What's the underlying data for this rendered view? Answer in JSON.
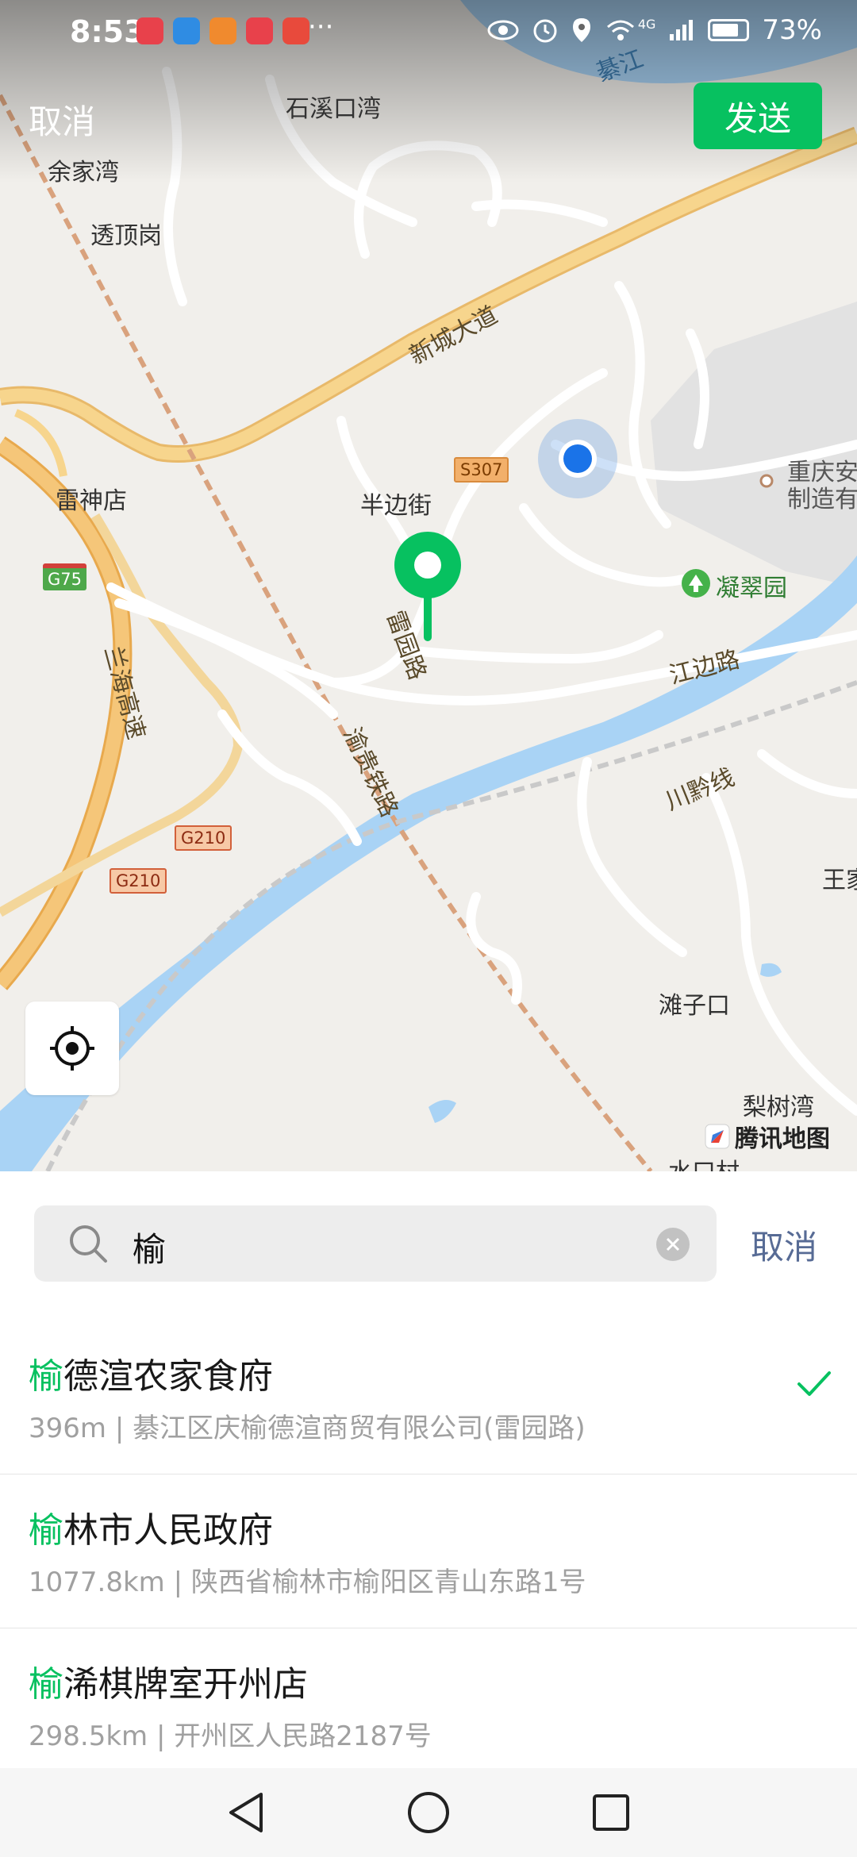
{
  "status_bar": {
    "time": "8:53",
    "more": "···",
    "network": "4G",
    "battery": "73%"
  },
  "header": {
    "cancel_label": "取消",
    "send_label": "发送"
  },
  "map": {
    "labels": {
      "shixikouwan": "石溪口湾",
      "yujiawan": "余家湾",
      "toudinggang": "透顶岗",
      "leishendian": "雷神店",
      "banbianjie": "半边街",
      "chongqing_an": "重庆安",
      "zhizaoyou": "制造有",
      "ningcuiyuan": "凝翠园",
      "tanzikou": "滩子口",
      "lishuwan": "梨树湾",
      "shuikoucun": "水口村",
      "wangjia": "王家",
      "qijiang": "綦江"
    },
    "roads": {
      "xinchengdadao": "新城大道",
      "leiyuanlu": "雷园路",
      "jiangbianlu": "江边路",
      "lanhaigaosu": "兰海高速",
      "yuguitielu": "渝贵铁路",
      "chuanqianxian": "川黔线"
    },
    "shields": {
      "s307": "S307",
      "g75": "G75",
      "g210_a": "G210",
      "g210_b": "G210"
    },
    "watermark": "腾讯地图"
  },
  "search": {
    "query": "榆",
    "cancel_label": "取消"
  },
  "results": [
    {
      "highlight": "榆",
      "rest": "德渲农家食府",
      "subtitle": "396m | 綦江区庆榆德渲商贸有限公司(雷园路)",
      "selected": true
    },
    {
      "highlight": "榆",
      "rest": "林市人民政府",
      "subtitle": "1077.8km | 陕西省榆林市榆阳区青山东路1号",
      "selected": false
    },
    {
      "highlight": "榆",
      "rest": "浠棋牌室开州店",
      "subtitle": "298.5km | 开州区人民路2187号",
      "selected": false
    }
  ],
  "colors": {
    "accent": "#07c160",
    "link": "#576b95",
    "water": "#a9d3f5",
    "expressway": "#f5c679"
  }
}
